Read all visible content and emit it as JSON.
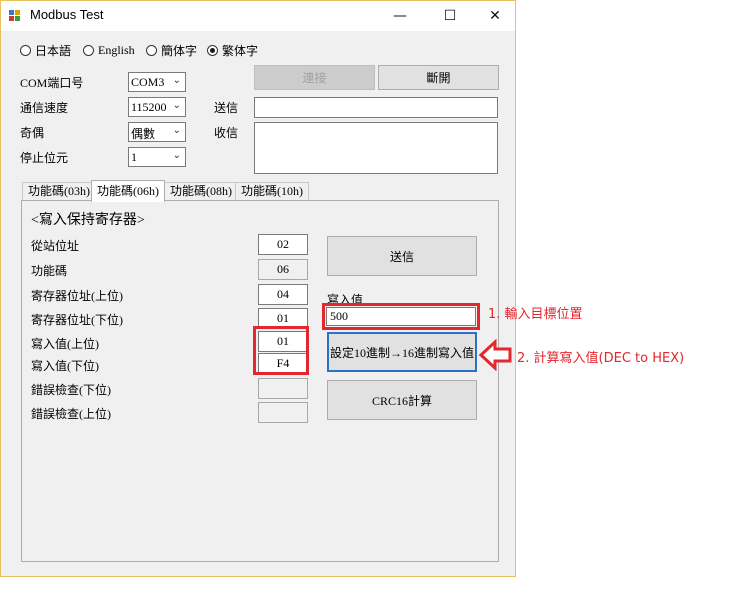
{
  "window": {
    "title": "Modbus Test",
    "minimize_glyph": "—",
    "maximize_glyph": "☐",
    "close_glyph": "✕"
  },
  "languages": [
    {
      "label": "日本語",
      "selected": false
    },
    {
      "label": "English",
      "selected": false
    },
    {
      "label": "簡体字",
      "selected": false
    },
    {
      "label": "繁体字",
      "selected": true
    }
  ],
  "serial": {
    "port_label": "COM端口号",
    "port_value": "COM3",
    "baud_label": "通信速度",
    "baud_value": "115200",
    "parity_label": "奇偶",
    "parity_value": "偶數",
    "stop_label": "停止位元",
    "stop_value": "1",
    "connect_label": "連接",
    "disconnect_label": "斷開",
    "send_label": "送信",
    "send_value": "",
    "recv_label": "收信",
    "recv_value": ""
  },
  "tabs": [
    {
      "label": "功能碼(03h)",
      "selected": false
    },
    {
      "label": "功能碼(06h)",
      "selected": true
    },
    {
      "label": "功能碼(08h)",
      "selected": false
    },
    {
      "label": "功能碼(10h)",
      "selected": false
    }
  ],
  "panel": {
    "title": "<寫入保持寄存器>",
    "slave_label": "從站位址",
    "slave_value": "02",
    "func_label": "功能碼",
    "func_value": "06",
    "reg_hi_label": "寄存器位址(上位)",
    "reg_hi_value": "04",
    "reg_lo_label": "寄存器位址(下位)",
    "reg_lo_value": "01",
    "val_hi_label": "寫入值(上位)",
    "val_hi_value": "01",
    "val_lo_label": "寫入值(下位)",
    "val_lo_value": "F4",
    "crc_lo_label": "錯誤檢查(下位)",
    "crc_lo_value": "",
    "crc_hi_label": "錯誤檢查(上位)",
    "crc_hi_value": "",
    "send_button": "送信",
    "write_value_label": "寫入值",
    "write_value": "500",
    "convert_button": "設定10進制→16進制寫入值",
    "crc_button": "CRC16計算"
  },
  "annotations": {
    "note1": "1. 輸入目標位置",
    "note2": "2. 計算寫入值(DEC to HEX)",
    "color": "#e4262d"
  }
}
